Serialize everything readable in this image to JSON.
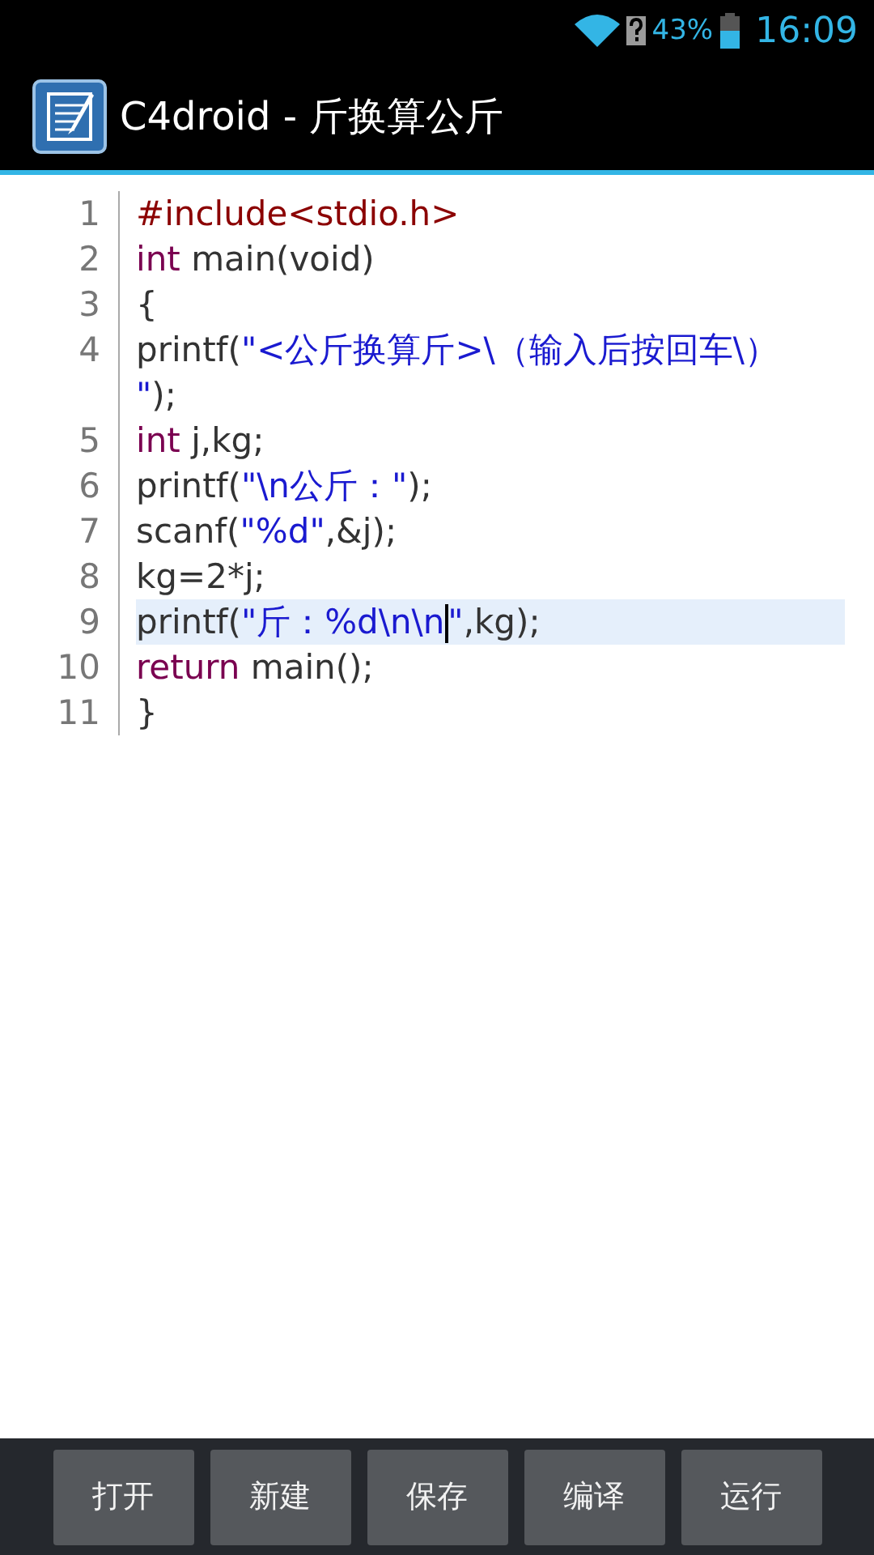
{
  "status_bar": {
    "battery": "43%",
    "time": "16:09"
  },
  "title_bar": {
    "title": "C4droid - 斤换算公斤"
  },
  "editor": {
    "lines": [
      {
        "number": "1",
        "selected": false,
        "rows": [
          [
            {
              "kind": "preprocessor",
              "text": "#include<stdio.h>"
            }
          ]
        ]
      },
      {
        "number": "2",
        "selected": false,
        "rows": [
          [
            {
              "kind": "keyword",
              "text": "int"
            },
            {
              "kind": "plain",
              "text": " main(void)"
            }
          ]
        ]
      },
      {
        "number": "3",
        "selected": false,
        "rows": [
          [
            {
              "kind": "plain",
              "text": "{"
            }
          ]
        ]
      },
      {
        "number": "4",
        "selected": false,
        "rows": [
          [
            {
              "kind": "plain",
              "text": "printf("
            },
            {
              "kind": "string",
              "text": "\"<公斤换算斤>\\（输入后按回车\\）"
            },
            {
              "kind": "wrap"
            },
            {
              "kind": "string",
              "text": "\""
            },
            {
              "kind": "plain",
              "text": ");"
            }
          ]
        ]
      },
      {
        "number": "5",
        "selected": false,
        "rows": [
          [
            {
              "kind": "keyword",
              "text": "int"
            },
            {
              "kind": "plain",
              "text": " j,kg;"
            }
          ]
        ]
      },
      {
        "number": "6",
        "selected": false,
        "rows": [
          [
            {
              "kind": "plain",
              "text": "printf("
            },
            {
              "kind": "string",
              "text": "\"\\n公斤：\""
            },
            {
              "kind": "plain",
              "text": ");"
            }
          ]
        ]
      },
      {
        "number": "7",
        "selected": false,
        "rows": [
          [
            {
              "kind": "plain",
              "text": "scanf("
            },
            {
              "kind": "string",
              "text": "\"%d\""
            },
            {
              "kind": "plain",
              "text": ",&j);"
            }
          ]
        ]
      },
      {
        "number": "8",
        "selected": false,
        "rows": [
          [
            {
              "kind": "plain",
              "text": "kg=2*j;"
            }
          ]
        ]
      },
      {
        "number": "9",
        "selected": true,
        "rows": [
          [
            {
              "kind": "plain",
              "text": "printf("
            },
            {
              "kind": "string",
              "text": "\"斤：%d\\n\\n"
            },
            {
              "kind": "cursor"
            },
            {
              "kind": "string",
              "text": "\""
            },
            {
              "kind": "plain",
              "text": ",kg);"
            }
          ]
        ]
      },
      {
        "number": "10",
        "selected": false,
        "rows": [
          [
            {
              "kind": "keyword",
              "text": "return"
            },
            {
              "kind": "plain",
              "text": " main();"
            }
          ]
        ]
      },
      {
        "number": "11",
        "selected": false,
        "rows": [
          [
            {
              "kind": "plain",
              "text": "}"
            }
          ]
        ]
      }
    ]
  },
  "toolbar": {
    "buttons": [
      "打开",
      "新建",
      "保存",
      "编译",
      "运行"
    ]
  }
}
